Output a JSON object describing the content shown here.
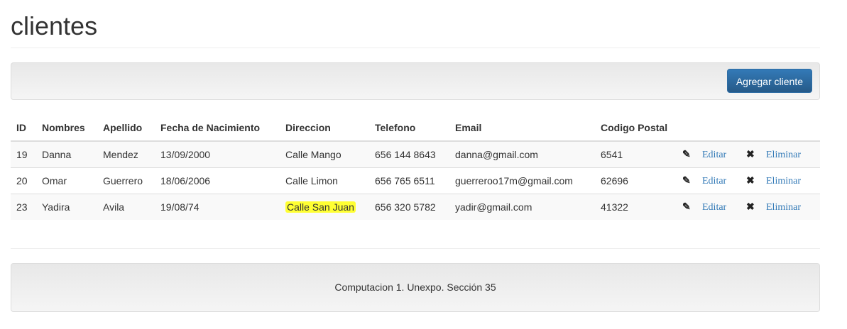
{
  "title": "clientes",
  "toolbar": {
    "add_label": "Agregar cliente"
  },
  "table": {
    "headers": [
      "ID",
      "Nombres",
      "Apellido",
      "Fecha de Nacimiento",
      "Direccion",
      "Telefono",
      "Email",
      "Codigo Postal"
    ],
    "rows": [
      {
        "id": "19",
        "nombres": "Danna",
        "apellido": "Mendez",
        "fecha": "13/09/2000",
        "direccion": "Calle Mango",
        "telefono": "656 144 8643",
        "email": "danna@gmail.com",
        "cp": "6541"
      },
      {
        "id": "20",
        "nombres": "Omar",
        "apellido": "Guerrero",
        "fecha": "18/06/2006",
        "direccion": "Calle Limon",
        "telefono": "656 765 6511",
        "email": "guerreroo17m@gmail.com",
        "cp": "62696"
      },
      {
        "id": "23",
        "nombres": "Yadira",
        "apellido": "Avila",
        "fecha": "19/08/74",
        "direccion": "Calle San Juan",
        "telefono": "656 320 5782",
        "email": "yadir@gmail.com",
        "cp": "41322"
      }
    ],
    "edit_label": "Editar",
    "delete_label": "Eliminar"
  },
  "footer": {
    "text": "Computacion 1. Unexpo. Sección 35"
  },
  "colors": {
    "primary": "#337ab7",
    "highlight": "#ffff33"
  }
}
